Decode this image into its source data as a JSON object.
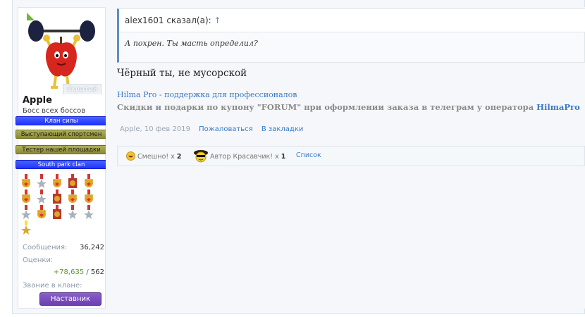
{
  "user": {
    "name": "Apple",
    "title": "Босс всех боссов",
    "hidden_badge": "Скрытый",
    "banners": [
      "Клан силы",
      "Выступающий спортсмен",
      "Тестер нашей площадки",
      "South park clan"
    ],
    "stats": {
      "messages_label": "Сообщения:",
      "messages_value": "36,242",
      "rating_label": "Оценки:",
      "rating_positive": "+78,635",
      "rating_separator": " / ",
      "rating_total": "562",
      "clan_rank_label": "Звание в клане:",
      "clan_rank_value": "Наставник"
    }
  },
  "post": {
    "quote_author": "alex1601 сказал(а):",
    "quote_arrow": "↑",
    "quote_text": "А похрен. Ты масть определил?",
    "message": "Чёрный ты, не мусорской",
    "signature_line1": "Hilma Pro - поддержка для профессионалов",
    "signature_line2_prefix": "Скидки и подарки по купону \"FORUM\" при оформлении заказа в телеграм у оператора ",
    "signature_line2_link": "HilmaPro",
    "meta_author": "Apple",
    "meta_date": "10 фев 2019",
    "report_label": "Пожаловаться",
    "bookmark_label": "В закладки"
  },
  "likes": {
    "funny_label": "Смешно!",
    "funny_mult": "x",
    "funny_count": "2",
    "author_label": "Автор Красавчик!",
    "author_mult": "x",
    "author_count": "1",
    "list_label": "Список"
  },
  "colors": {
    "link": "#3b7ac6",
    "quote_border": "#5f8dc2",
    "positive": "#5a9b2c",
    "clan_banner": "#1f33ff",
    "mentor": "#6b3fb0"
  }
}
